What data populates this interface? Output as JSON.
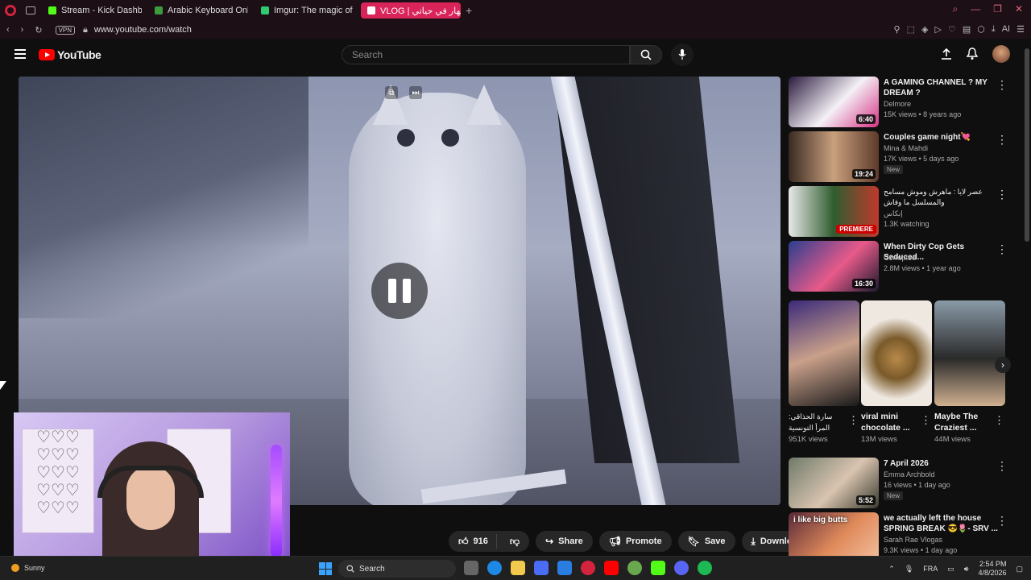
{
  "browser": {
    "tabs": [
      {
        "label": "Stream - Kick Dashboard",
        "color": "#53fc18"
      },
      {
        "label": "Arabic Keyboard Online •",
        "color": "#3c9b3c"
      },
      {
        "label": "Imgur: The magic of the In",
        "color": "#2ecc71"
      },
      {
        "label": "VLOG | نهار في حياتي 😊",
        "color": "#ff0000"
      }
    ],
    "vpn_label": "VPN",
    "url": "www.youtube.com/watch",
    "ai_label": "AI"
  },
  "header": {
    "logo_text": "YouTube",
    "search_placeholder": "Search"
  },
  "player": {
    "state": "paused-overlay"
  },
  "actions": {
    "likes": "916",
    "share": "Share",
    "promote": "Promote",
    "save": "Save",
    "download": "Download"
  },
  "recommendations": [
    {
      "title": "A GAMING CHANNEL ? MY DREAM ?",
      "channel": "Delmore",
      "meta": "15K views • 8 years ago",
      "duration": "6:40",
      "badge": "",
      "colors": [
        "#2a1a3e",
        "#f4f0f6",
        "#d63384"
      ]
    },
    {
      "title": "Couples game night💘",
      "channel": "Mina & Mahdi",
      "meta": "17K views • 5 days ago",
      "duration": "19:24",
      "badge": "New",
      "colors": [
        "#3a2a22",
        "#c9a07d",
        "#5d3a2a"
      ]
    },
    {
      "title": "عصر لايا : ماهرش وموش مسامح والمسلسل ما وفاش",
      "channel": "إنكاس",
      "meta": "1.3K watching",
      "duration": "",
      "premiere": "PREMIERE",
      "badge": "",
      "colors": [
        "#e8e8e8",
        "#2f5d2f",
        "#c0392b"
      ]
    },
    {
      "title": "When Dirty Cop Gets Seduced...",
      "channel": "Corrupted",
      "meta": "2.8M views • 1 year ago",
      "duration": "16:30",
      "badge": "",
      "colors": [
        "#2a3e8f",
        "#e85a8a",
        "#1a1a2e"
      ]
    },
    {
      "title": "7 April 2026",
      "channel": "Emma Archbold",
      "meta": "16 views • 1 day ago",
      "duration": "5:52",
      "badge": "New",
      "colors": [
        "#6f7a6a",
        "#d9c4b0",
        "#3a3a2e"
      ]
    },
    {
      "title": "we actually left the house SPRING BREAK 😎🌷- SRV ...",
      "channel": "Sarah Rae Vlogas",
      "meta": "9.3K views • 1 day ago",
      "duration": "",
      "badge": "",
      "overlay": "i like big butts",
      "colors": [
        "#5a2a3a",
        "#e08a5a",
        "#f2c0a0"
      ]
    }
  ],
  "shorts": [
    {
      "title": "سارة الحذاقي: المرأ التونسية",
      "views": "951K views",
      "colors": [
        "#3b2a7a",
        "#c9a08a",
        "#1a1a1a"
      ]
    },
    {
      "title": "viral mini chocolate ...",
      "views": "13M views",
      "colors": [
        "#efe8e0",
        "#b88a4a",
        "#7a5a2a"
      ]
    },
    {
      "title": "Maybe The Craziest ...",
      "views": "44M views",
      "colors": [
        "#8a9aa8",
        "#2a2a2a",
        "#d0b090"
      ]
    }
  ],
  "taskbar": {
    "weather": "Sunny",
    "search": "Search",
    "lang": "FRA",
    "time": "2:54 PM",
    "date": "4/8/2026"
  }
}
